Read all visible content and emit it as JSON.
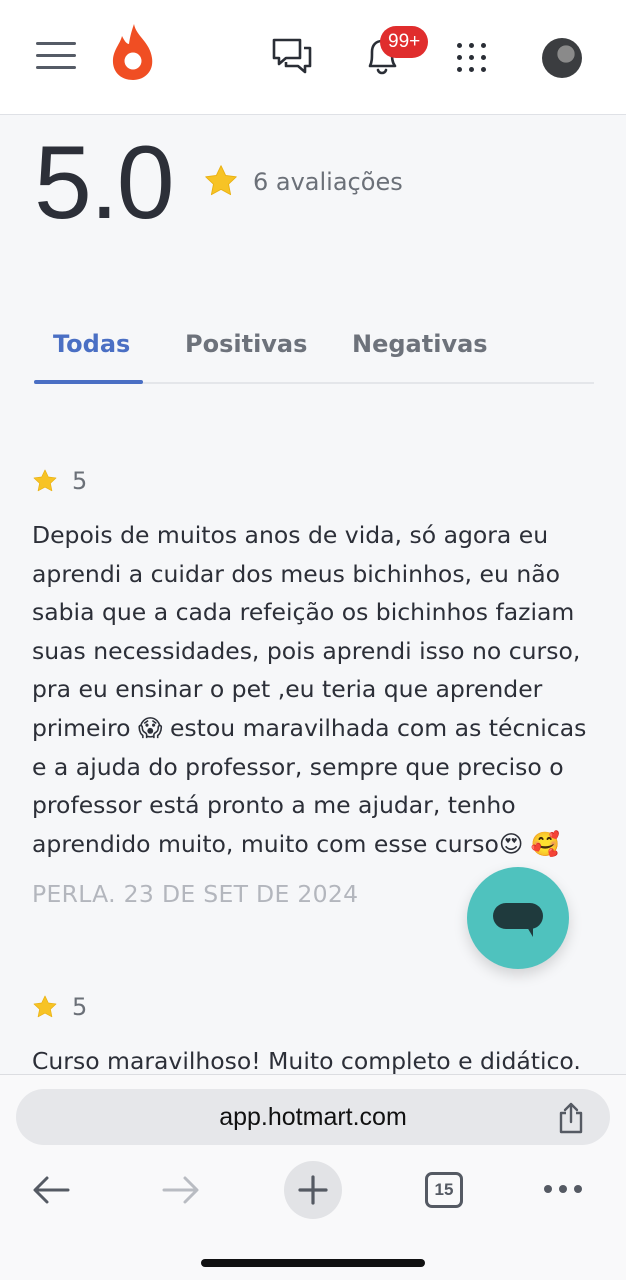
{
  "header": {
    "notifications_badge": "99+",
    "brand_color": "#f04e23",
    "icons": [
      "menu-icon",
      "hotmart-flame-logo",
      "chat-icon",
      "bell-icon",
      "apps-grid-icon",
      "avatar"
    ]
  },
  "summary": {
    "score": "5.0",
    "reviews_label": "6 avaliações"
  },
  "tabs": [
    {
      "label": "Todas",
      "active": true
    },
    {
      "label": "Positivas",
      "active": false
    },
    {
      "label": "Negativas",
      "active": false
    }
  ],
  "reviews": [
    {
      "rating": "5",
      "text": "Depois de muitos anos de vida, só agora eu aprendi a cuidar dos meus bichinhos, eu não sabia que a cada refeição os bichinhos faziam suas necessidades, pois aprendi isso no curso, pra eu ensinar o pet ,eu teria que aprender primeiro 😱 estou maravilhada com as técnicas e a ajuda do professor, sempre que preciso o professor está pronto a me ajudar, tenho aprendido muito, muito com esse curso😍 🥰",
      "meta": "PERLA. 23 DE SET DE 2024"
    },
    {
      "rating": "5",
      "text": "Curso maravilhoso! Muito completo e didático."
    }
  ],
  "browser": {
    "url": "app.hotmart.com",
    "tabs_count": "15"
  },
  "colors": {
    "accent": "#4a6fc4",
    "star": "#f7c325",
    "fab": "#4fc2be",
    "badge": "#e02d2d"
  }
}
